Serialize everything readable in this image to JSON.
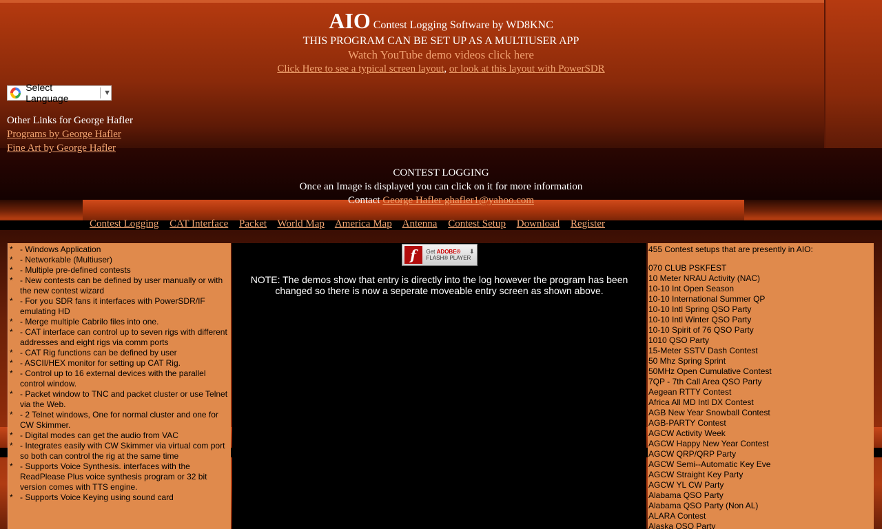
{
  "header": {
    "title_big": "AIO",
    "title_rest": "Contest Logging Software by WD8KNC",
    "multiuser": "THIS PROGRAM CAN BE SET UP AS A MULTIUSER APP",
    "youtube": "Watch YouTube demo videos click here",
    "screen_layout_link": "Click Here to see a typical screen layout",
    "comma": ", ",
    "powersdr_link": "or look at this layout with PowerSDR"
  },
  "language": {
    "label": "Select Language",
    "arrow": "▼"
  },
  "other_links": {
    "heading": "Other Links for George Hafler",
    "programs": "Programs by George Hafler",
    "fine_art": "Fine Art by George Hafler"
  },
  "contest": {
    "heading": "CONTEST LOGGING",
    "image_note": "Once an Image is displayed you can click on it for more information",
    "contact_label": "Contact",
    "contact_link": "George Hafler ghafler1@yahoo.com"
  },
  "nav": [
    "Contest Logging",
    "CAT Interface",
    "Packet",
    "World Map",
    "America Map",
    "Antenna",
    "Contest Setup",
    "Download",
    "Register"
  ],
  "features": [
    "- Windows Application",
    "- Networkable (Multiuser)",
    "- Multiple pre-defined contests",
    "- New contests can be defined by user manually or with the new contest wizard",
    "- For you SDR fans it interfaces with PowerSDR/IF emulating HD",
    "- Merge multiple Cabrilo files into one.",
    "- CAT interface can control up to seven rigs with different addresses and eight rigs via comm ports",
    "- CAT Rig functions can be defined by user",
    "- ASCII/HEX monitor for setting up CAT Rig.",
    "- Control up to 16 external devices with the parallel control window.",
    "- Packet window to TNC and packet cluster or use Telnet via the Web.",
    "- 2 Telnet windows, One for  normal cluster and one for CW Skimmer.",
    "- Digital modes can get the audio from VAC",
    "- Integrates easily with CW Skimmer via virtual com port so both can control the rig at the same time",
    "- Supports Voice Synthesis. interfaces with the ReadPlease Plus voice synthesis program or 32 bit version comes with TTS engine.",
    "- Supports Voice Keying using sound card"
  ],
  "feature_star": "*",
  "flash": {
    "get": "Get",
    "adobe": "ADOBE®",
    "player": "FLASH® PLAYER",
    "logo": "f"
  },
  "note": "NOTE: The demos show that entry is directly into the log however the program has been changed so there is now a seperate moveable entry screen as shown above.",
  "contests": {
    "heading": "455 Contest setups that are presently in AIO:",
    "items": [
      "070 CLUB PSKFEST",
      "10 Meter NRAU Activity (NAC)",
      "10-10 Int Open Season",
      "10-10 International Summer QP",
      "10-10 Intl Spring QSO Party",
      "10-10 Intl Winter QSO Party",
      "10-10 Spirit of 76 QSO Party",
      "1010 QSO Party",
      "15-Meter SSTV Dash Contest",
      "50 Mhz Spring Sprint",
      "50MHz Open Cumulative Contest",
      "7QP - 7th Call Area QSO Party",
      "Aegean RTTY Contest",
      "Africa All MD Intl DX Contest",
      "AGB New Year Snowball Contest",
      "AGB-PARTY Contest",
      "AGCW Activity Week",
      "AGCW Happy New Year Contest",
      "AGCW QRP/QRP Party",
      "AGCW Semi--Automatic Key Eve",
      "AGCW Straight Key Party",
      "AGCW YL CW Party",
      "Alabama QSO Party",
      "Alabama QSO Party (Non AL)",
      "ALARA Contest",
      "Alaska QSO Party"
    ]
  }
}
